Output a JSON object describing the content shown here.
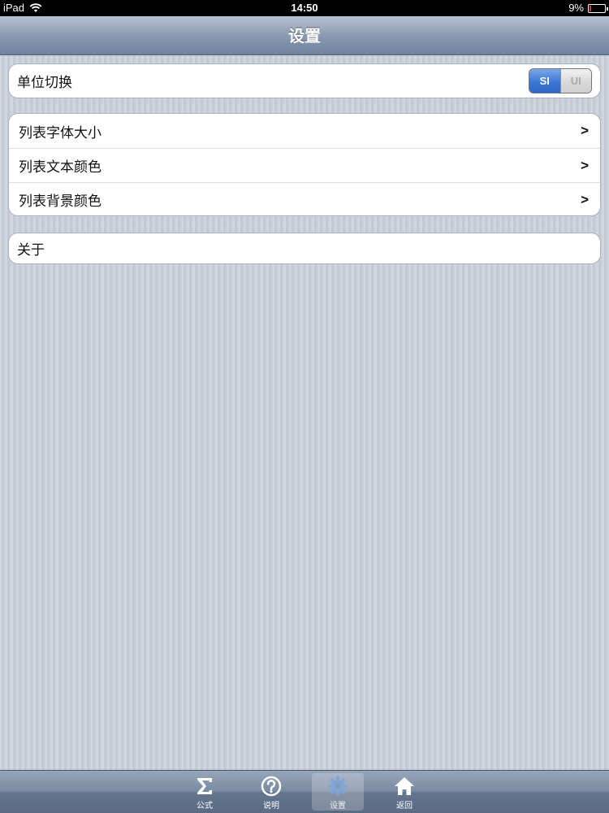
{
  "status_bar": {
    "device": "iPad",
    "time": "14:50",
    "battery": "9%",
    "battery_level": 0.09
  },
  "nav": {
    "title": "设置"
  },
  "groups": {
    "unit": {
      "label": "单位切换",
      "segments": [
        "SI",
        "UI"
      ],
      "selected": "SI"
    },
    "list": {
      "items": [
        {
          "label": "列表字体大小",
          "accessory": ">"
        },
        {
          "label": "列表文本颜色",
          "accessory": ">"
        },
        {
          "label": "列表背景颜色",
          "accessory": ">"
        }
      ]
    },
    "about": {
      "label": "关于"
    }
  },
  "tab_bar": {
    "items": [
      {
        "label": "公式",
        "icon": "sigma-icon"
      },
      {
        "label": "说明",
        "icon": "question-icon"
      },
      {
        "label": "设置",
        "icon": "gear-icon",
        "active": true
      },
      {
        "label": "返回",
        "icon": "home-icon"
      }
    ]
  },
  "colors": {
    "accent": "#3c77d6",
    "nav_bar": "#8a9bb2",
    "background": "#c8ced8"
  }
}
